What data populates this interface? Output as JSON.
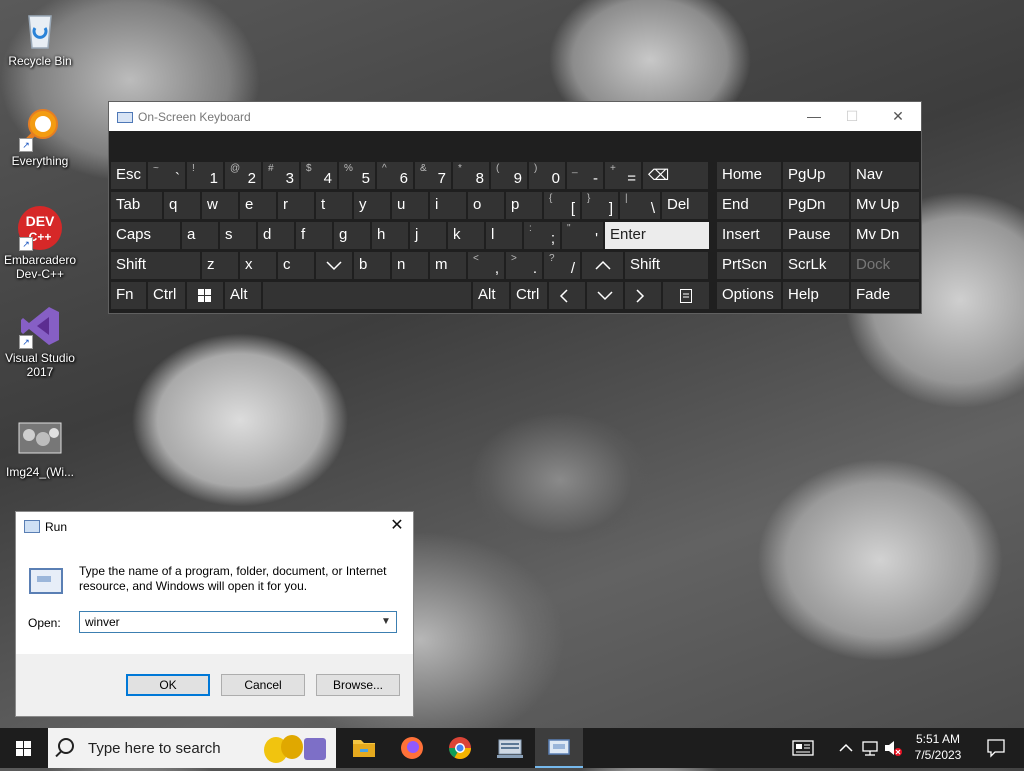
{
  "desktop": {
    "icons": [
      {
        "label": "Recycle Bin"
      },
      {
        "label": "Everything"
      },
      {
        "label": "Embarcadero Dev-C++"
      },
      {
        "label": "Visual Studio 2017"
      },
      {
        "label": "Img24_(Wi..."
      }
    ],
    "devcpp_logo_text": "DEV\nC++"
  },
  "osk": {
    "title": "On-Screen Keyboard",
    "controls": {
      "minimize": "—",
      "maximize": "☐",
      "close": "✕"
    },
    "rows": [
      [
        {
          "m": "Esc"
        },
        {
          "t": "~",
          "b": "`"
        },
        {
          "t": "!",
          "b": "1"
        },
        {
          "t": "@",
          "b": "2"
        },
        {
          "t": "#",
          "b": "3"
        },
        {
          "t": "$",
          "b": "4"
        },
        {
          "t": "%",
          "b": "5"
        },
        {
          "t": "^",
          "b": "6"
        },
        {
          "t": "&",
          "b": "7"
        },
        {
          "t": "*",
          "b": "8"
        },
        {
          "t": "(",
          "b": "9"
        },
        {
          "t": ")",
          "b": "0"
        },
        {
          "t": "_",
          "b": "-"
        },
        {
          "t": "+",
          "b": "="
        },
        {
          "m": "⌫"
        }
      ],
      [
        {
          "m": "Tab"
        },
        {
          "m": "q"
        },
        {
          "m": "w"
        },
        {
          "m": "e"
        },
        {
          "m": "r"
        },
        {
          "m": "t"
        },
        {
          "m": "y"
        },
        {
          "m": "u"
        },
        {
          "m": "i"
        },
        {
          "m": "o"
        },
        {
          "m": "p"
        },
        {
          "t": "{",
          "b": "["
        },
        {
          "t": "}",
          "b": "]"
        },
        {
          "t": "|",
          "b": "\\"
        },
        {
          "m": "Del"
        }
      ],
      [
        {
          "m": "Caps"
        },
        {
          "m": "a"
        },
        {
          "m": "s"
        },
        {
          "m": "d"
        },
        {
          "m": "f"
        },
        {
          "m": "g"
        },
        {
          "m": "h"
        },
        {
          "m": "j"
        },
        {
          "m": "k"
        },
        {
          "m": "l"
        },
        {
          "t": ":",
          "b": ";"
        },
        {
          "t": "\"",
          "b": "'"
        },
        {
          "m": "Enter"
        }
      ],
      [
        {
          "m": "Shift"
        },
        {
          "m": "z"
        },
        {
          "m": "x"
        },
        {
          "m": "c"
        },
        {
          "m": "v"
        },
        {
          "m": "b"
        },
        {
          "m": "n"
        },
        {
          "m": "m"
        },
        {
          "t": "<",
          "b": ","
        },
        {
          "t": ">",
          "b": "."
        },
        {
          "t": "?",
          "b": "/"
        },
        {
          "m": "^"
        },
        {
          "m": "Shift"
        }
      ],
      [
        {
          "m": "Fn"
        },
        {
          "m": "Ctrl"
        },
        {
          "m": "win"
        },
        {
          "m": "Alt"
        },
        {
          "m": ""
        },
        {
          "m": "Alt"
        },
        {
          "m": "Ctrl"
        },
        {
          "m": "<"
        },
        {
          "m": "v"
        },
        {
          "m": ">"
        },
        {
          "m": "menu"
        }
      ]
    ],
    "nav": [
      [
        "Home",
        "PgUp",
        "Nav"
      ],
      [
        "End",
        "PgDn",
        "Mv Up"
      ],
      [
        "Insert",
        "Pause",
        "Mv Dn"
      ],
      [
        "PrtScn",
        "ScrLk",
        "Dock"
      ],
      [
        "Options",
        "Help",
        "Fade"
      ]
    ]
  },
  "run": {
    "title": "Run",
    "close": "✕",
    "description": "Type the name of a program, folder, document, or Internet resource, and Windows will open it for you.",
    "open_label": "Open:",
    "input_value": "winver",
    "buttons": {
      "ok": "OK",
      "cancel": "Cancel",
      "browse": "Browse..."
    }
  },
  "taskbar": {
    "search_placeholder": "Type here to search",
    "clock_time": "5:51 AM",
    "clock_date": "7/5/2023",
    "colors": {
      "background": "#1d1d1d",
      "accent": "#76b9ed"
    }
  }
}
